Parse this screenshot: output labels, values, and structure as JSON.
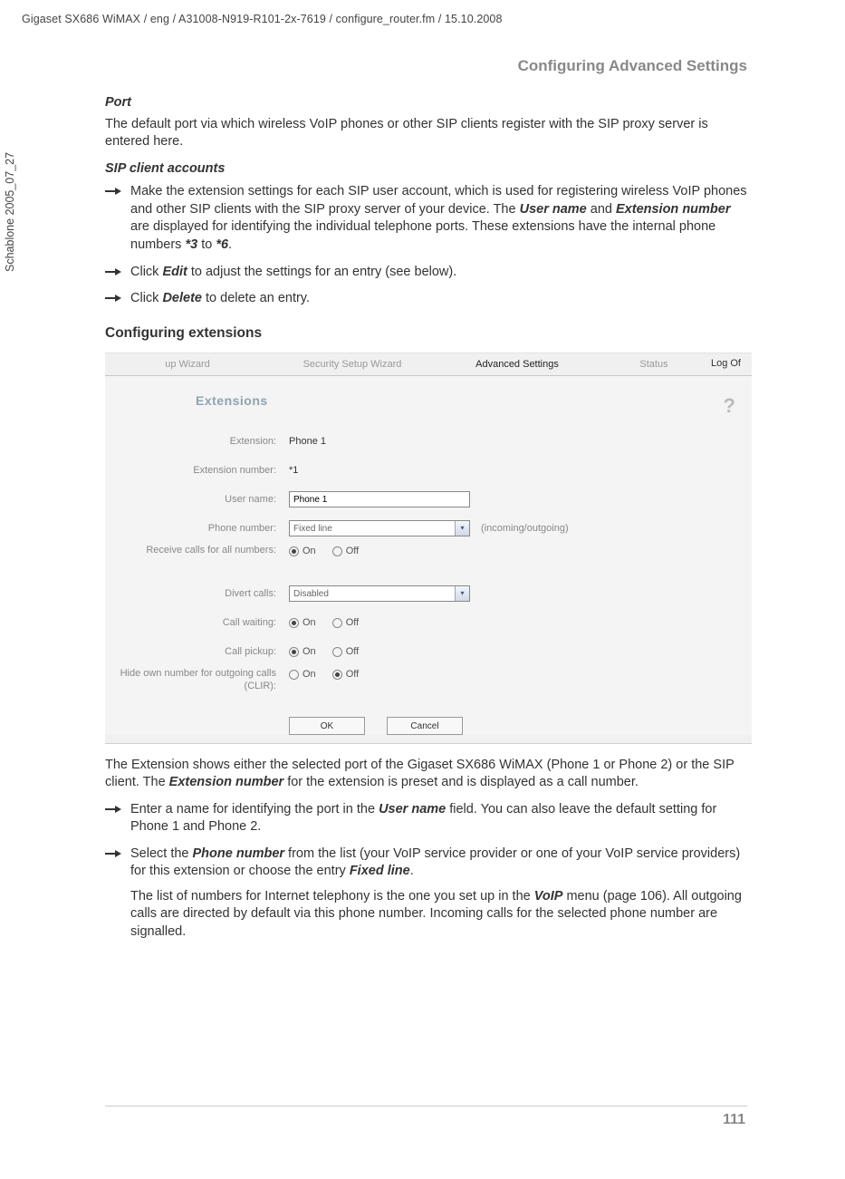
{
  "header": {
    "line": "Gigaset SX686 WiMAX / eng / A31008-N919-R101-2x-7619 / configure_router.fm / 15.10.2008",
    "sideways": "Schablone 2005_07_27",
    "section": "Configuring Advanced Settings"
  },
  "text": {
    "port_h": "Port",
    "port_p": "The default port via which wireless VoIP phones or other SIP clients register with the SIP proxy server is entered here.",
    "sip_h": "SIP client accounts",
    "step1a": "Make the extension settings for each SIP user account, which is used for registering wireless VoIP phones and other SIP clients with the SIP proxy server of your device. The ",
    "step1b": "User name",
    "step1c": " and ",
    "step1d": "Extension number",
    "step1e": " are displayed for identifying the individual telephone ports. These extensions have the internal phone numbers ",
    "step1f": "*3",
    "step1g": " to ",
    "step1h": "*6",
    "step1i": ".",
    "step2a": "Click ",
    "step2b": "Edit",
    "step2c": " to adjust the settings for an entry (see below).",
    "step3a": "Click ",
    "step3b": "Delete",
    "step3c": " to delete an entry.",
    "config_h": "Configuring extensions",
    "after1a": "The Extension shows either the selected port of the Gigaset SX686 WiMAX (Phone 1 or Phone 2) or the SIP client. The ",
    "after1b": "Extension number",
    "after1c": " for the extension is preset and is displayed as a call number.",
    "after2a": "Enter a name for identifying the port in the ",
    "after2b": "User name",
    "after2c": " field. You can also leave the default setting for Phone 1 and Phone 2.",
    "after3a": "Select the ",
    "after3b": "Phone number",
    "after3c": " from the list (your VoIP service provider or one of your VoIP service providers) for this extension or choose the entry ",
    "after3d": "Fixed line",
    "after3e": ".",
    "after3f": "The list of numbers for Internet telephony is the one you set up in the ",
    "after3g": "VoIP",
    "after3h": " menu (page 106). All outgoing calls are directed by default via this phone number. Incoming calls for the selected phone number are signalled."
  },
  "ui": {
    "tabs": [
      "up Wizard",
      "Security Setup Wizard",
      "Advanced Settings",
      "Status"
    ],
    "logoff": "Log Of",
    "panel_title": "Extensions",
    "help": "?",
    "labels": {
      "extension": "Extension:",
      "ext_num": "Extension number:",
      "user": "User name:",
      "phone": "Phone number:",
      "recv": "Receive calls for all numbers:",
      "divert": "Divert calls:",
      "wait": "Call waiting:",
      "pickup": "Call pickup:",
      "clir": "Hide own number for outgoing calls (CLIR):"
    },
    "values": {
      "extension": "Phone 1",
      "ext_num": "*1",
      "user": "Phone 1",
      "phone": "Fixed line",
      "phone_aside": "(incoming/outgoing)",
      "divert": "Disabled",
      "on": "On",
      "off": "Off"
    },
    "buttons": {
      "ok": "OK",
      "cancel": "Cancel"
    }
  },
  "page_number": "111"
}
